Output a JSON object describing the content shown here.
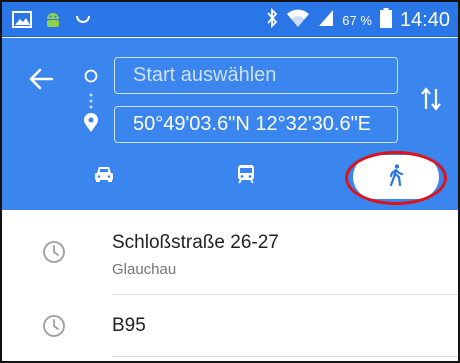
{
  "status_bar": {
    "battery_percent": "67 %",
    "time": "14:40",
    "icons": [
      "image-icon",
      "android-icon",
      "sync-icon",
      "bluetooth-icon",
      "wifi-icon",
      "signal-icon",
      "battery-icon"
    ]
  },
  "header": {
    "start_placeholder": "Start auswählen",
    "destination_value": "50°49'03.6\"N 12°32'30.6\"E",
    "colors": {
      "primary": "#3b86ee",
      "statusbar": "#2a76e6",
      "highlight_ring": "#d9141a"
    }
  },
  "modes": [
    {
      "name": "car-icon",
      "selected": false
    },
    {
      "name": "transit-icon",
      "selected": false
    },
    {
      "name": "walk-icon",
      "selected": true
    }
  ],
  "recent": [
    {
      "title": "Schloßstraße 26-27",
      "subtitle": "Glauchau"
    },
    {
      "title": "B95",
      "subtitle": ""
    }
  ]
}
